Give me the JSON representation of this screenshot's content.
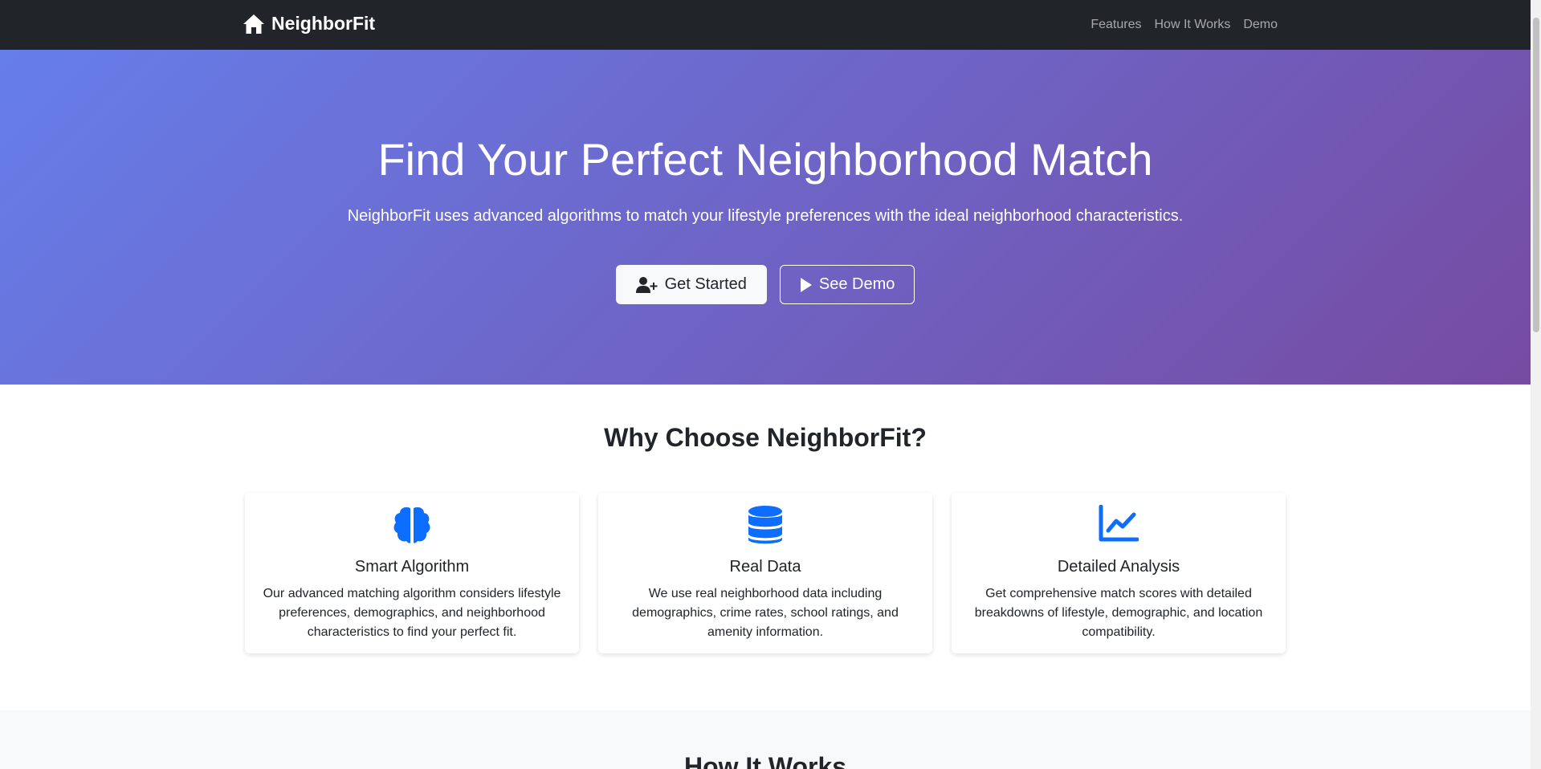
{
  "nav": {
    "brand": "NeighborFit",
    "links": [
      "Features",
      "How It Works",
      "Demo"
    ]
  },
  "hero": {
    "title": "Find Your Perfect Neighborhood Match",
    "lead": "NeighborFit uses advanced algorithms to match your lifestyle preferences with the ideal neighborhood characteristics.",
    "primary_button": "Get Started",
    "secondary_button": "See Demo"
  },
  "features": {
    "title": "Why Choose NeighborFit?",
    "cards": [
      {
        "icon": "brain-icon",
        "title": "Smart Algorithm",
        "text": "Our advanced matching algorithm considers lifestyle preferences, demographics, and neighborhood characteristics to find your perfect fit."
      },
      {
        "icon": "database-icon",
        "title": "Real Data",
        "text": "We use real neighborhood data including demographics, crime rates, school ratings, and amenity information."
      },
      {
        "icon": "chart-line-icon",
        "title": "Detailed Analysis",
        "text": "Get comprehensive match scores with detailed breakdowns of lifestyle, demographic, and location compatibility."
      }
    ]
  },
  "how_it_works": {
    "title": "How It Works"
  },
  "colors": {
    "navbar": "#212529",
    "gradient_start": "#667eea",
    "gradient_end": "#764ba2",
    "icon_primary": "#0d6efd"
  }
}
